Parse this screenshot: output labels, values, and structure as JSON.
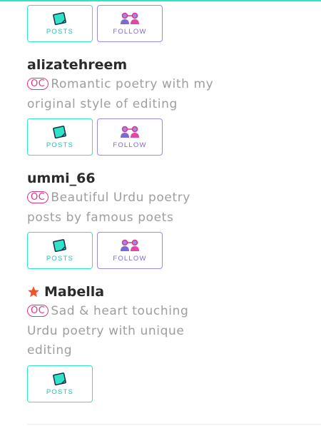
{
  "colors": {
    "accent_teal": "#2fe3c8",
    "follow_purple": "#9c88e6",
    "badge_pink": "#e0338a",
    "star_orange": "#f0522a"
  },
  "buttons": {
    "posts_label": "POSTS",
    "follow_label": "FOLLOW"
  },
  "profiles": [
    {
      "name": "alizatehreem",
      "badge": "OC",
      "description": "Romantic poetry with my original style of editing",
      "starred": false
    },
    {
      "name": "ummi_66",
      "badge": "OC",
      "description": "Beautiful Urdu poetry posts by famous poets",
      "starred": false
    },
    {
      "name": "Mabella",
      "badge": "OC",
      "description": "Sad & heart touching Urdu poetry with unique editing",
      "starred": true,
      "star_icon": "star-icon"
    }
  ]
}
